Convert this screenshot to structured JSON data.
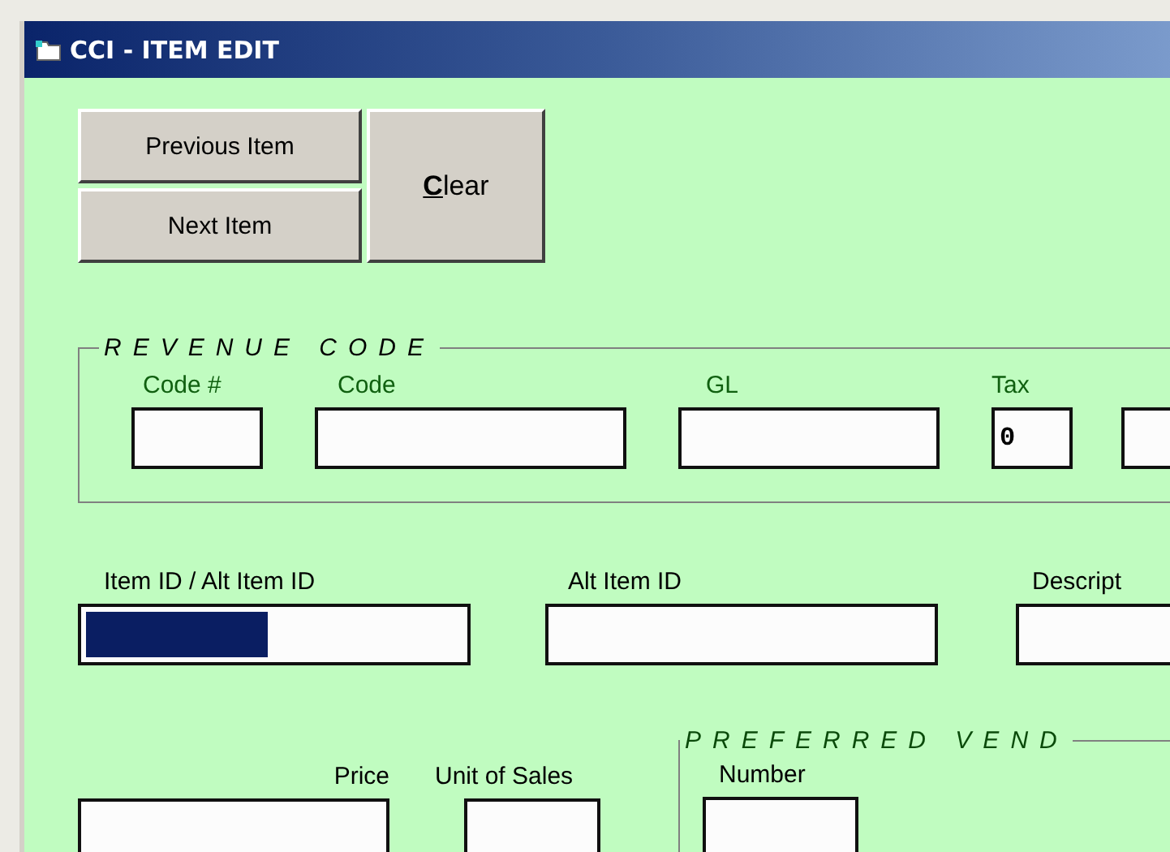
{
  "window": {
    "title": "CCI - ITEM EDIT"
  },
  "nav_buttons": [
    {
      "label": "Previous Item"
    },
    {
      "label": "Next Item"
    }
  ],
  "clear_button": {
    "label": "**C**lear"
  },
  "revenue_code": {
    "title": "REVENUE CODE",
    "fields": [
      {
        "kind": "text",
        "label": "Code #"
      },
      {
        "kind": "text",
        "label": "Code"
      },
      {
        "kind": "text",
        "label": "GL"
      },
      {
        "kind": "text",
        "label": "Tax",
        "value": "0"
      },
      {
        "kind": "text"
      }
    ]
  },
  "item_fields": [
    {
      "label": "Item ID / Alt Item ID",
      "text_selected": true
    },
    {
      "label": "Alt Item ID",
      "text_selected": false
    },
    {
      "label": "Descript",
      "text_selected": false
    }
  ],
  "price": {
    "label": "Price"
  },
  "unit_of_sales": {
    "label": "Unit of Sales"
  },
  "preferred_vendor": {
    "title": "PREFERRED VEND",
    "number_label": "Number"
  }
}
